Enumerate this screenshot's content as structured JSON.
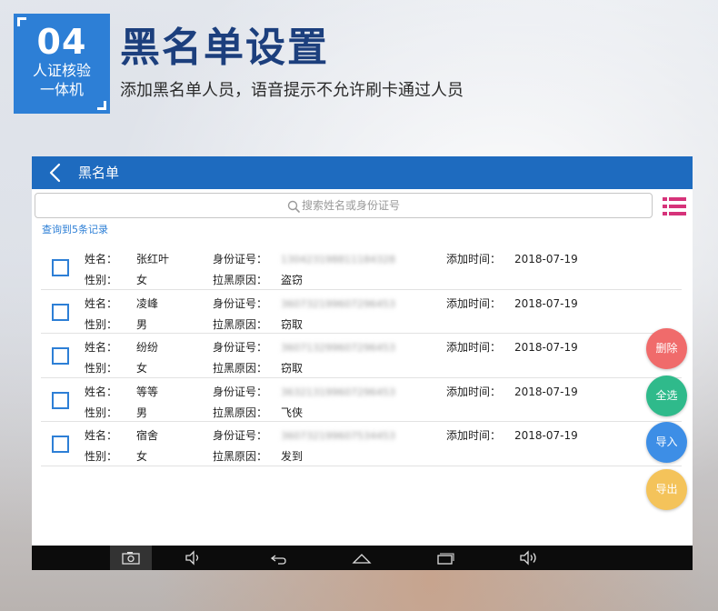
{
  "header": {
    "badge_number": "04",
    "badge_line1": "人证核验",
    "badge_line2": "一体机",
    "title": "黑名单设置",
    "subtitle": "添加黑名单人员，语音提示不允许刷卡通过人员"
  },
  "app": {
    "title": "黑名单",
    "search_placeholder": "搜索姓名或身份证号",
    "result_count": "查询到5条记录",
    "labels": {
      "name": "姓名：",
      "gender": "性别：",
      "id_number": "身份证号：",
      "reason": "拉黑原因：",
      "added_time": "添加时间："
    },
    "records": [
      {
        "name": "张红叶",
        "gender": "女",
        "id_number": "130423198811184328",
        "reason": "盗窃",
        "added_time": "2018-07-19",
        "checked": false
      },
      {
        "name": "凌峰",
        "gender": "男",
        "id_number": "360732199607296453",
        "reason": "窃取",
        "added_time": "2018-07-19",
        "checked": false
      },
      {
        "name": "纷纷",
        "gender": "女",
        "id_number": "360713299607296453",
        "reason": "窃取",
        "added_time": "2018-07-19",
        "checked": false
      },
      {
        "name": "等等",
        "gender": "男",
        "id_number": "363213199607296453",
        "reason": "飞侠",
        "added_time": "2018-07-19",
        "checked": false
      },
      {
        "name": "宿舍",
        "gender": "女",
        "id_number": "360732199607534453",
        "reason": "发到",
        "added_time": "2018-07-19",
        "checked": false
      }
    ],
    "actions": {
      "delete": "删除",
      "select_all": "全选",
      "import": "导入",
      "export": "导出"
    },
    "colors": {
      "appbar": "#1e6bbf",
      "accent": "#2d7fd6",
      "delete": "#f06b6b",
      "select_all": "#2fba8b",
      "import": "#3d8ee6",
      "export": "#f4c35a",
      "menu_icon": "#d6337a"
    },
    "icons": {
      "back": "chevron-left",
      "search": "magnifier",
      "menu": "list",
      "nav": [
        "camera",
        "volume-down",
        "back-arrow",
        "home",
        "recent-apps",
        "volume-up"
      ]
    }
  }
}
